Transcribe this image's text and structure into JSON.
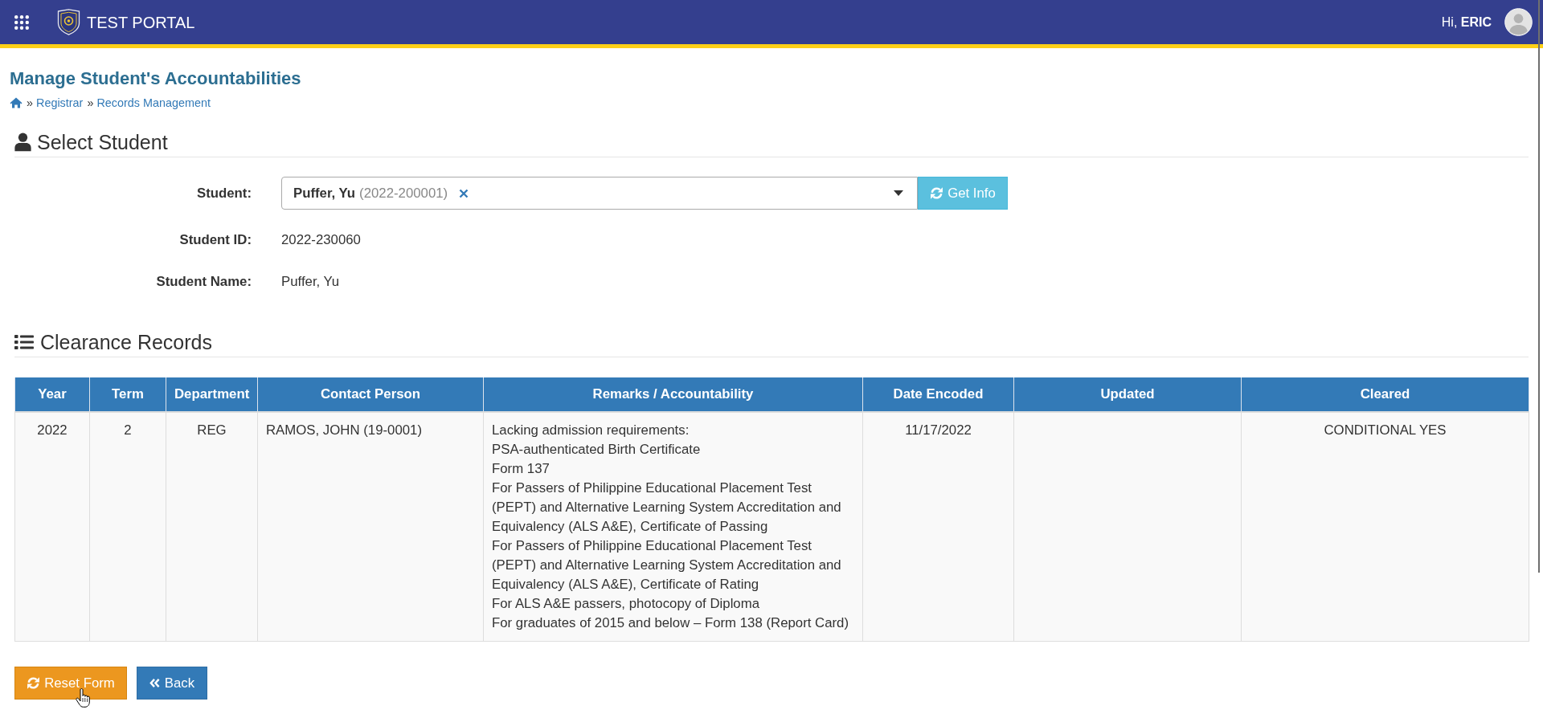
{
  "header": {
    "title": "TEST PORTAL",
    "greeting": "Hi, **ERIC**"
  },
  "page": {
    "title": "Manage Student's Accountabilities",
    "breadcrumb": [
      {
        "separator": "»",
        "label": "Registrar"
      },
      {
        "separator": "»",
        "label": "Records Management"
      }
    ]
  },
  "select_student": {
    "heading": "Select Student",
    "student_field": {
      "label": "Student:",
      "value_name": "Puffer, Yu",
      "value_id": "(2022-200001)"
    },
    "get_info_button": "Get Info",
    "fields": [
      {
        "label": "Student ID:",
        "value": "2022-230060"
      },
      {
        "label": "Student Name:",
        "value": "Puffer, Yu"
      }
    ]
  },
  "clearance_records": {
    "heading": "Clearance Records",
    "table": {
      "columns": [
        "Year",
        "Term",
        "Department",
        "Contact Person",
        "Remarks / Accountability",
        "Date Encoded",
        "Updated",
        "Cleared"
      ],
      "rows": [
        {
          "cells": [
            "2022",
            "2",
            "REG",
            "RAMOS, JOHN (19-0001)",
            [
              "Lacking admission requirements:",
              "PSA-authenticated Birth Certificate",
              "Form 137",
              "For Passers of Philippine Educational Placement Test (PEPT) and Alternative Learning System Accreditation and Equivalency (ALS A&E), Certificate of Passing",
              "For Passers of Philippine Educational Placement Test (PEPT) and Alternative Learning System Accreditation and Equivalency (ALS A&E), Certificate of Rating",
              "For ALS A&E passers, photocopy of Diploma",
              "For graduates of 2015 and below – Form 138 (Report Card)"
            ],
            "11/17/2022",
            null,
            "CONDITIONAL YES"
          ]
        }
      ]
    }
  },
  "buttons": [
    {
      "kind": "reset",
      "label": "Reset Form"
    },
    {
      "kind": "back",
      "label": "Back"
    }
  ]
}
